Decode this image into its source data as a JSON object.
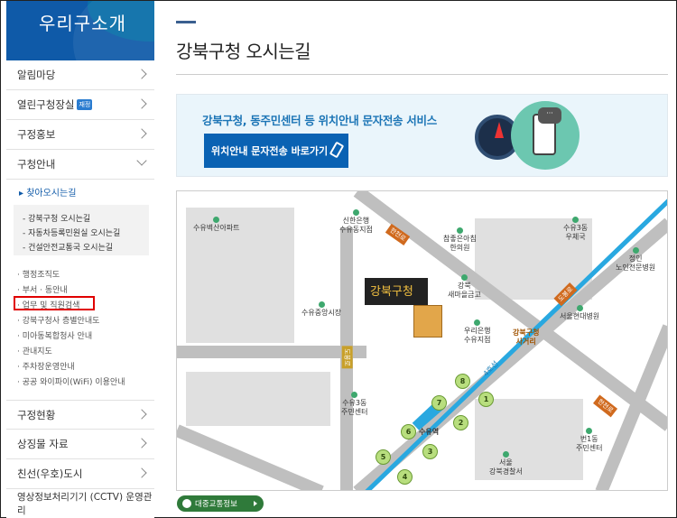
{
  "sidebar": {
    "brand_title": "우리구소개",
    "menu": [
      {
        "label": "알림마당"
      },
      {
        "label": "열린구청장실",
        "badge": "재정"
      },
      {
        "label": "구정홍보"
      },
      {
        "label": "구청안내"
      }
    ],
    "current": "▸ 찾아오시는길",
    "level3": [
      "- 강북구청 오시는길",
      "- 자동차등록민원실 오시는길",
      "- 건설안전교통국 오시는길"
    ],
    "level2": [
      "· 행정조직도",
      "· 부서 · 동안내",
      "· 업무 및 직원검색",
      "· 강북구청사 층별안내도",
      "· 미아동복합청사 안내",
      "· 관내지도",
      "· 주차장운영안내",
      "· 공공 와이파이(WiFi) 이용안내"
    ],
    "bottom_menu": [
      {
        "label": "구정현황"
      },
      {
        "label": "상징물 자료"
      },
      {
        "label": "친선(우호)도시"
      },
      {
        "label": "영상정보처리기기 (CCTV) 운영관리"
      }
    ]
  },
  "main": {
    "page_title": "강북구청 오시는길",
    "banner": {
      "text": "강북구청, 동주민센터 등 위치안내 문자전송 서비스",
      "button_label": "위치안내 문자전송 바로가기",
      "bubble": "···"
    },
    "map": {
      "labels": {
        "suyu_byucksan": "수유벽산아파트",
        "shinhan": "신한은행\n수유동지점",
        "hansan_road": "한천로",
        "chamjoeun": "참좋은아침\n한의원",
        "suyu3_post": "수유3동\n우체국",
        "jeongin": "정인\n노인전문병원",
        "gangbuk_saemaul": "강북\n새마을금고",
        "dobong_road": "도봉로",
        "suyu_market": "수유중앙시장",
        "seoul_hyundai": "서울현대병원",
        "woori": "우리은행\n수유지점",
        "gangbuk_crossroad": "강북구청\n사거리",
        "line4": "4호선",
        "hansan_road2": "한천로",
        "suyu3_center": "수유3동\n주민센터",
        "suyu_station": "수유역",
        "beon1_center": "번1동\n주민센터",
        "police": "서울\n강북경찰서",
        "hq_sign": "강북구청"
      },
      "exits": [
        "1",
        "2",
        "3",
        "4",
        "5",
        "6",
        "7",
        "8"
      ]
    },
    "transit_button": "대중교통정보"
  },
  "colors": {
    "brand_blue": "#0f5aa8",
    "highlight_red": "#e00000",
    "line4_blue": "#29a8e0"
  }
}
